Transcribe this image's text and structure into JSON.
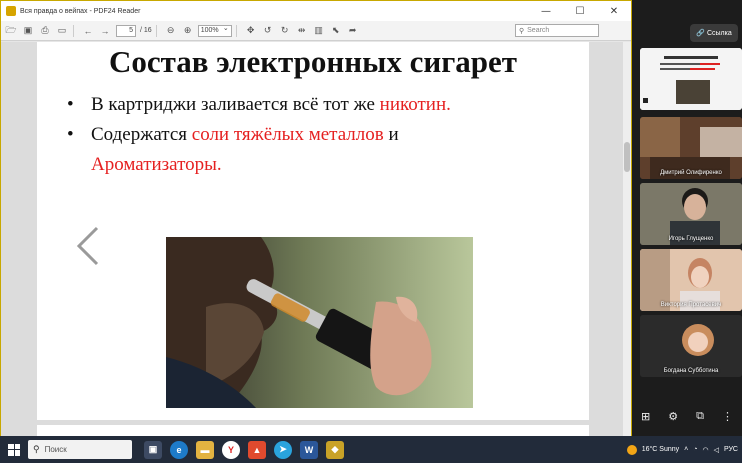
{
  "window": {
    "title": "Вся правда о вейпах - PDF24 Reader",
    "controls": {
      "minimize": "—",
      "maximize": "☐",
      "close": "✕"
    }
  },
  "toolbar": {
    "page_current": "5",
    "page_total": "/ 16",
    "zoom": "100%",
    "search_placeholder": "Search"
  },
  "slide": {
    "title": "Состав электронных сигарет",
    "bullet1_text": "В картриджи заливается всё тот же ",
    "bullet1_red": "никотин.",
    "bullet2_text": "Содержатся ",
    "bullet2_red": "соли тяжёлых металлов",
    "bullet2_tail": " и",
    "bullet2_line2_red": "Ароматизаторы."
  },
  "panel": {
    "link_label": "Ссылка",
    "participants": [
      "Дмитрий Олифиренко",
      "Игорь Глущенко",
      "Виктория Протасевич",
      "Богдана Субботина"
    ]
  },
  "taskbar": {
    "search_label": "Поиск",
    "weather": "16°C  Sunny",
    "lang": "РУС"
  }
}
